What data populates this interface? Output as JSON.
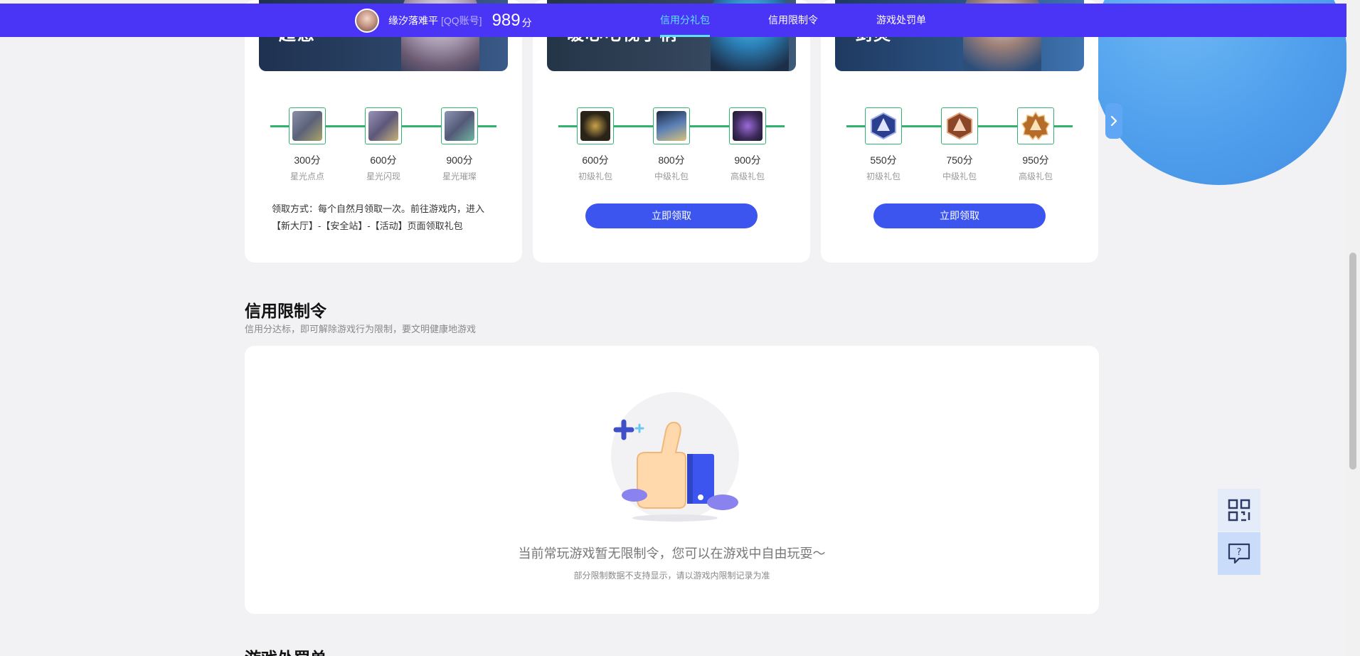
{
  "colors": {
    "nav": "#4a34f5",
    "accent": "#3b55ee",
    "track": "#2fb36f",
    "activeTab": "#5fe0ff"
  },
  "topnav": {
    "user_name": "缘汐落难平",
    "account_tag": "[QQ账号]",
    "score": "989",
    "score_unit": "分",
    "tabs": [
      {
        "label": "信用分礼包",
        "active": true
      },
      {
        "label": "信用限制令",
        "active": false
      },
      {
        "label": "游戏处罚单",
        "active": false
      }
    ]
  },
  "cards": [
    {
      "banner_text": "超感",
      "tiers": [
        {
          "points": "300分",
          "level": "星光点点"
        },
        {
          "points": "600分",
          "level": "星光闪现"
        },
        {
          "points": "900分",
          "level": "星光璀璨"
        }
      ],
      "note": "领取方式：每个自然月领取一次。前往游戏内，进入【新大厅】-【安全站】-【活动】页面领取礼包"
    },
    {
      "banner_text": "暖心电视手柄",
      "tiers": [
        {
          "points": "600分",
          "level": "初级礼包"
        },
        {
          "points": "800分",
          "level": "中级礼包"
        },
        {
          "points": "900分",
          "level": "高级礼包"
        }
      ],
      "claim_label": "立即领取"
    },
    {
      "banner_text": "剑灵",
      "tiers": [
        {
          "points": "550分",
          "level": "初级礼包"
        },
        {
          "points": "750分",
          "level": "中级礼包"
        },
        {
          "points": "950分",
          "level": "高级礼包"
        }
      ],
      "claim_label": "立即领取"
    }
  ],
  "restriction": {
    "title": "信用限制令",
    "subtitle": "信用分达标，即可解除游戏行为限制，要文明健康地游戏",
    "empty_message": "当前常玩游戏暂无限制令，您可以在游戏中自由玩耍～",
    "empty_sub": "部分限制数据不支持显示，请以游戏内限制记录为准"
  },
  "penalty": {
    "title": "游戏处罚单"
  },
  "icons": [
    "qr-code-icon",
    "help-chat-icon",
    "chevron-right-icon",
    "thumbs-up-illustration"
  ]
}
